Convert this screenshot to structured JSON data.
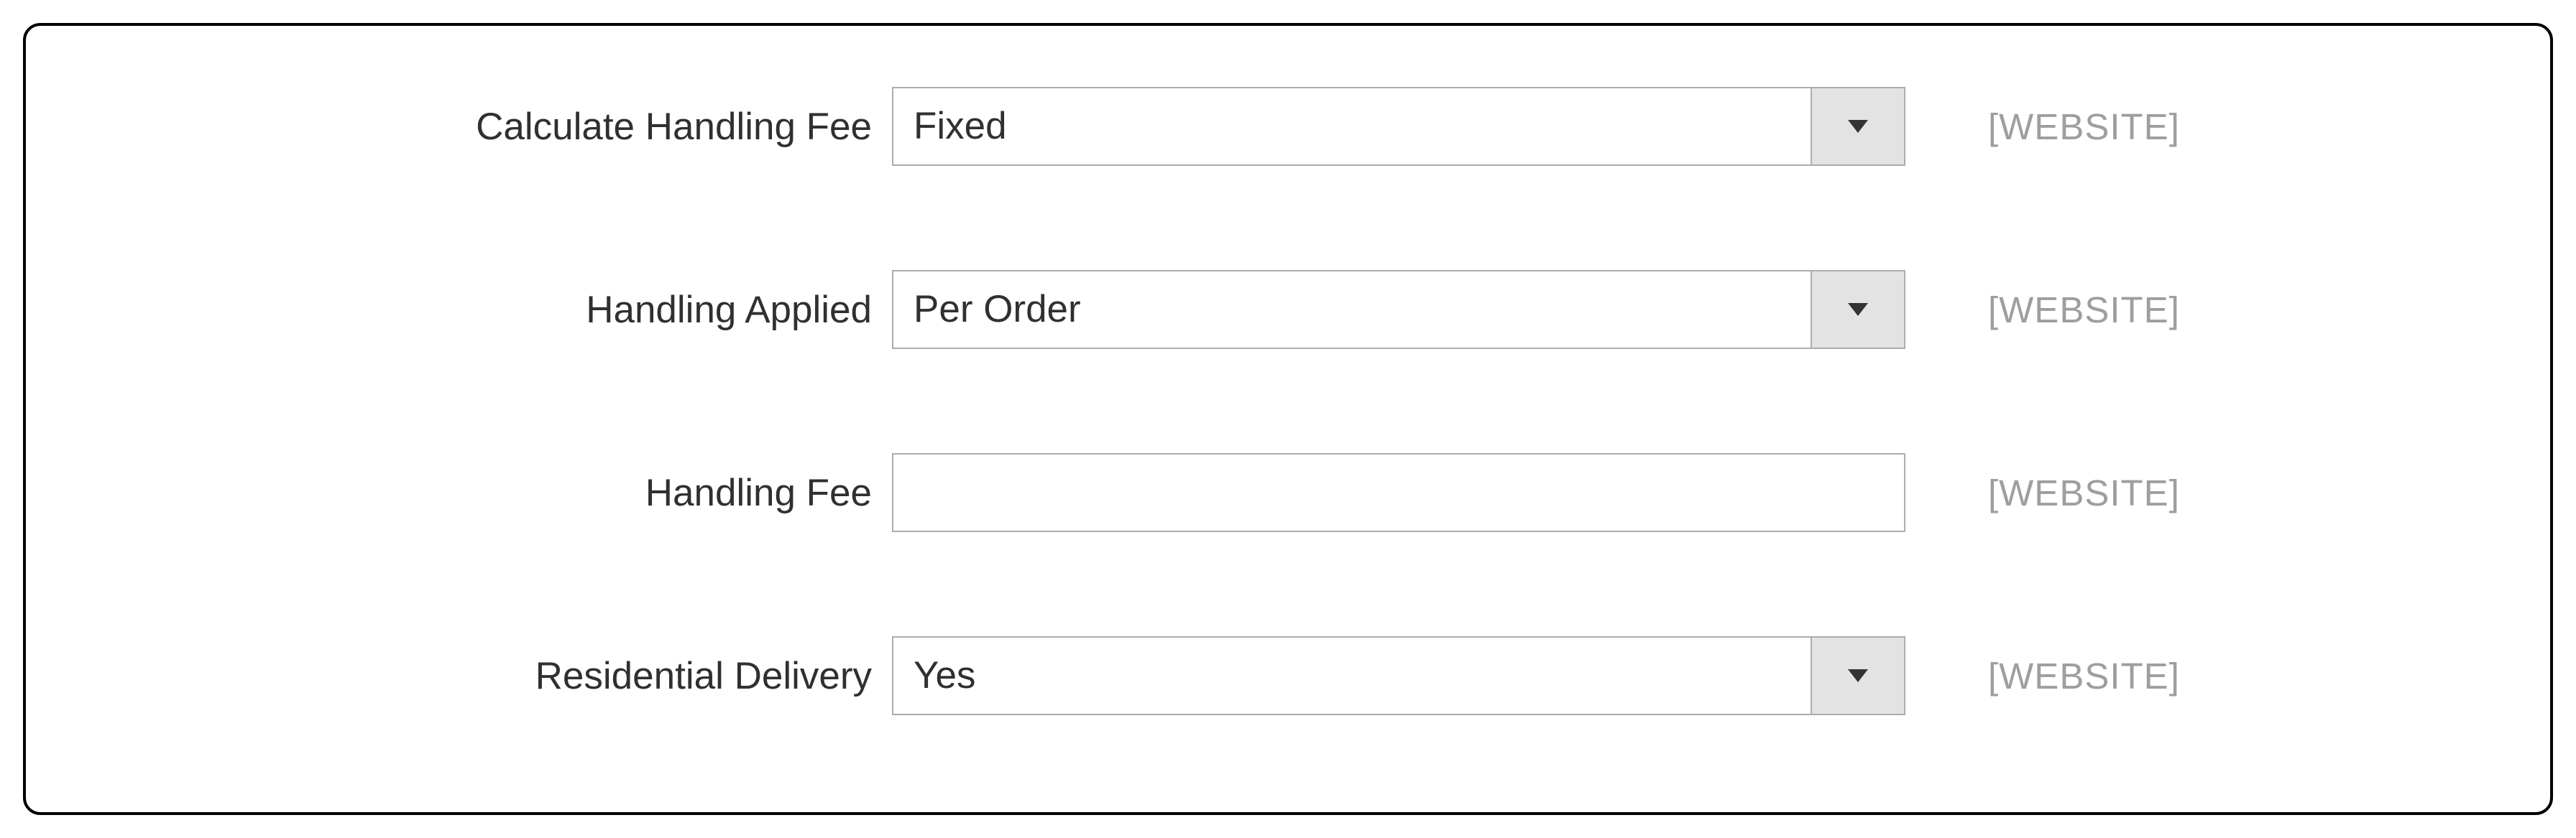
{
  "fields": {
    "calculate_handling_fee": {
      "label": "Calculate Handling Fee",
      "value": "Fixed",
      "scope": "[WEBSITE]"
    },
    "handling_applied": {
      "label": "Handling Applied",
      "value": "Per Order",
      "scope": "[WEBSITE]"
    },
    "handling_fee": {
      "label": "Handling Fee",
      "value": "",
      "scope": "[WEBSITE]"
    },
    "residential_delivery": {
      "label": "Residential Delivery",
      "value": "Yes",
      "scope": "[WEBSITE]"
    }
  }
}
